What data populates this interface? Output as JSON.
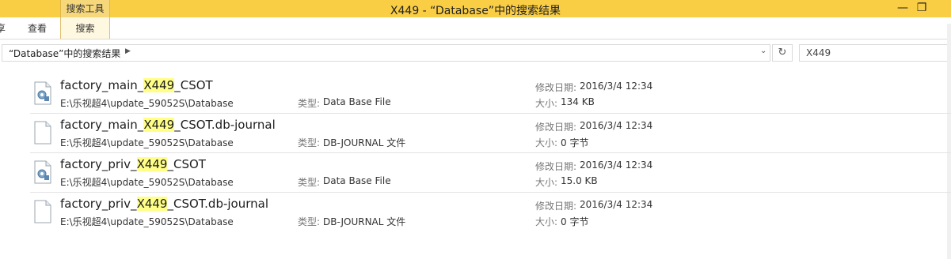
{
  "window": {
    "title": "X449 - “Database”中的搜索结果",
    "context_tab_header": "搜索工具",
    "colors": {
      "titlebar": "#f9cd44",
      "highlight": "#ffff88"
    }
  },
  "ribbon": {
    "tabs": [
      {
        "label": "享"
      },
      {
        "label": "查看"
      },
      {
        "label": "搜索"
      }
    ]
  },
  "address": {
    "path": "“Database”中的搜索结果",
    "search_query": "X449"
  },
  "labels": {
    "type": "类型:",
    "modified": "修改日期:",
    "size": "大小:"
  },
  "results": [
    {
      "name_pre": "factory_main_",
      "name_hl": "X449",
      "name_post": "_CSOT",
      "path": "E:\\乐视超4\\update_59052S\\Database",
      "type": "Data Base File",
      "modified": "2016/3/4 12:34",
      "size": "134 KB",
      "icon": "database-file-icon"
    },
    {
      "name_pre": "factory_main_",
      "name_hl": "X449",
      "name_post": "_CSOT.db-journal",
      "path": "E:\\乐视超4\\update_59052S\\Database",
      "type": "DB-JOURNAL 文件",
      "modified": "2016/3/4 12:34",
      "size": "0 字节",
      "icon": "blank-file-icon"
    },
    {
      "name_pre": "factory_priv_",
      "name_hl": "X449",
      "name_post": "_CSOT",
      "path": "E:\\乐视超4\\update_59052S\\Database",
      "type": "Data Base File",
      "modified": "2016/3/4 12:34",
      "size": "15.0 KB",
      "icon": "database-file-icon"
    },
    {
      "name_pre": "factory_priv_",
      "name_hl": "X449",
      "name_post": "_CSOT.db-journal",
      "path": "E:\\乐视超4\\update_59052S\\Database",
      "type": "DB-JOURNAL 文件",
      "modified": "2016/3/4 12:34",
      "size": "0 字节",
      "icon": "blank-file-icon"
    }
  ]
}
